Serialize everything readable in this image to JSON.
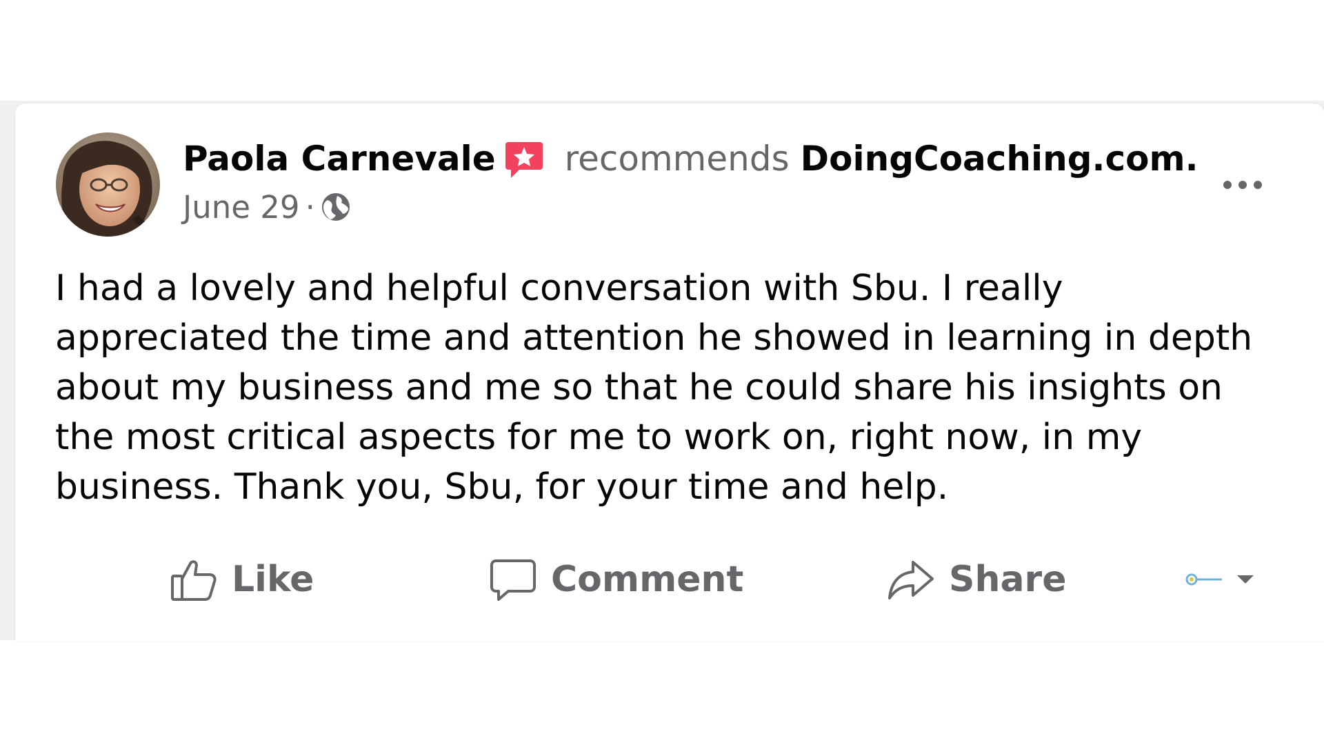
{
  "post": {
    "author": {
      "name": "Paola Carnevale",
      "badge_icon": "recommendation-star-icon",
      "avatar": "avatar-photo"
    },
    "recommends_text": "recommends",
    "page_name": "DoingCoaching.com",
    "page_name_suffix": ".",
    "date": "June 29",
    "separator": "·",
    "audience_icon": "globe-icon",
    "more_icon": "more-options-icon",
    "body": "I had a lovely and helpful conversation with Sbu. I really appreciated the time and attention he showed in learning in depth about my business and me so that he could share his insights on the most critical aspects for me to work on, right now, in my business. Thank you, Sbu, for your time and help."
  },
  "actions": {
    "like": {
      "label": "Like",
      "icon": "thumbs-up-icon"
    },
    "comment": {
      "label": "Comment",
      "icon": "comment-bubble-icon"
    },
    "share": {
      "label": "Share",
      "icon": "share-arrow-icon"
    },
    "audience_selector_icon": "chevron-down-icon"
  },
  "colors": {
    "text_primary": "#050505",
    "text_secondary": "#65676b",
    "badge": "#f3425f",
    "background_band": "#eef0f2",
    "card": "#ffffff"
  }
}
